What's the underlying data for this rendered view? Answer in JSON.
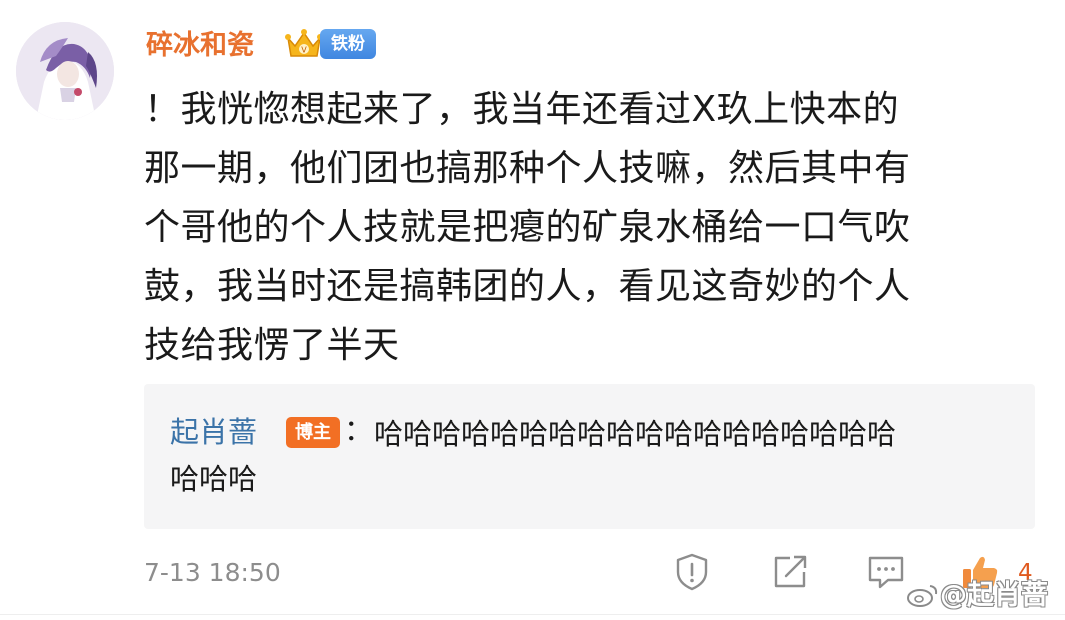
{
  "comment": {
    "username": "碎冰和瓷",
    "fan_badge": "铁粉",
    "text": "！我恍惚想起来了，我当年还看过X玖上快本的\n那一期，他们团也搞那种个人技嘛，然后其中有\n个哥他的个人技就是把瘪的矿泉水桶给一口气吹\n鼓，我当时还是搞韩团的人，看见这奇妙的个人\n技给我愣了半天",
    "timestamp": "7-13  18:50",
    "like_count": "4"
  },
  "reply": {
    "author": "起肖蔷",
    "badge": "博主",
    "colon": "：",
    "text_line1": "哈哈哈哈哈哈哈哈哈哈哈哈哈哈哈哈哈哈",
    "text_line2": "哈哈哈"
  },
  "watermark": {
    "text": "@起肖蔷"
  },
  "icons": {
    "report": "report-icon",
    "share": "share-icon",
    "comment": "comment-icon",
    "like": "thumbs-up-icon"
  },
  "colors": {
    "username": "#e8712f",
    "reply_author": "#3b73a8",
    "blogger_badge": "#f26f24",
    "fan_badge": "#4a8fe5",
    "like_active": "#e05a1f"
  }
}
